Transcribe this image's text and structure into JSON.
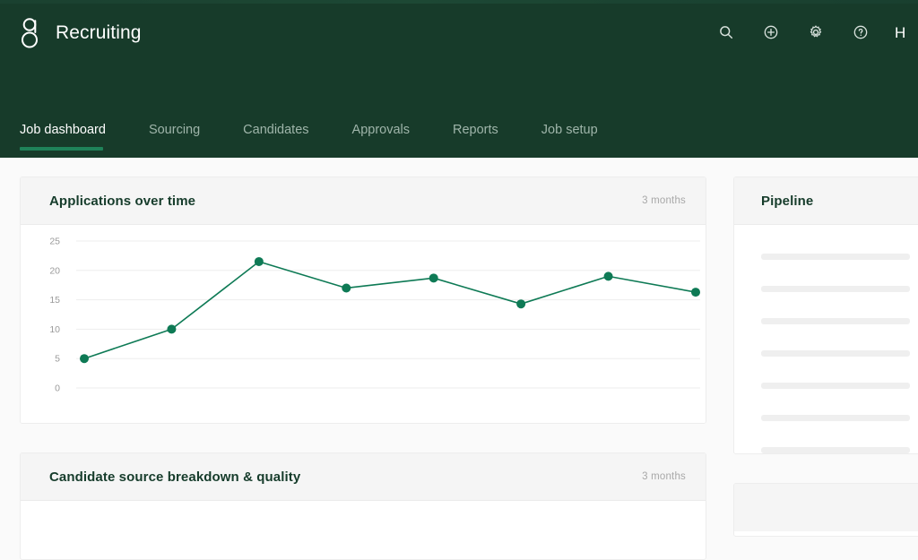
{
  "theme": {
    "header_bg": "#173b2a",
    "accent_green": "#1f8259",
    "series_green": "#0e7a55",
    "page_bg": "#fafafa",
    "card_head_bg": "#f5f5f5"
  },
  "header": {
    "logo_icon": "figure-g-logo-icon",
    "title": "Recruiting",
    "actions": [
      {
        "name": "search-icon",
        "label": "Search"
      },
      {
        "name": "add-circle-icon",
        "label": "Create"
      },
      {
        "name": "gear-icon",
        "label": "Settings"
      },
      {
        "name": "help-circle-icon",
        "label": "Help"
      }
    ],
    "avatar_initial": "H"
  },
  "tabs": [
    {
      "label": "Job dashboard",
      "active": true
    },
    {
      "label": "Sourcing",
      "active": false
    },
    {
      "label": "Candidates",
      "active": false
    },
    {
      "label": "Approvals",
      "active": false
    },
    {
      "label": "Reports",
      "active": false
    },
    {
      "label": "Job setup",
      "active": false
    }
  ],
  "cards": {
    "applications": {
      "title": "Applications over time",
      "range": "3 months"
    },
    "sources": {
      "title": "Candidate source breakdown & quality",
      "range": "3 months"
    },
    "pipeline": {
      "title": "Pipeline",
      "skeleton_rows": 7
    }
  },
  "chart_data": {
    "type": "line",
    "title": "Applications over time",
    "xlabel": "",
    "ylabel": "",
    "ylim": [
      0,
      25
    ],
    "yticks": [
      25,
      20,
      15,
      10,
      5,
      0
    ],
    "grid": true,
    "legend": null,
    "x": [
      1,
      2,
      3,
      4,
      5,
      6,
      7,
      8
    ],
    "values": [
      5,
      10,
      21.5,
      17,
      18.7,
      14.3,
      19,
      16.3
    ],
    "marker": "circle",
    "color": "#0e7a55"
  }
}
